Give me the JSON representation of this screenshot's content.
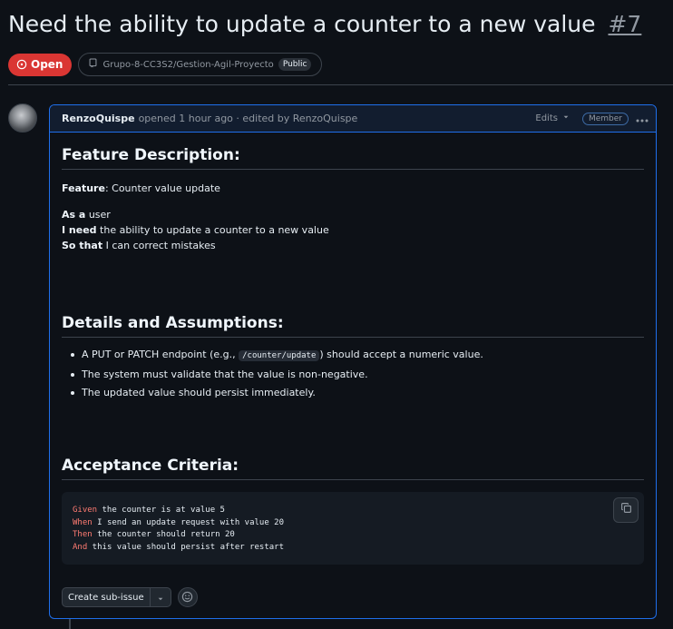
{
  "issue": {
    "title": "Need the ability to update a counter to a new value",
    "number": "#7",
    "state": "Open",
    "repo": "Grupo-8-CC3S2/Gestion-Agil-Proyecto",
    "visibility": "Public"
  },
  "comment": {
    "author": "RenzoQuispe",
    "meta": "opened 1 hour ago · edited by RenzoQuispe",
    "edits_label": "Edits",
    "role_badge": "Member",
    "sections": {
      "feature_heading": "Feature Description:",
      "feature_label": "Feature",
      "feature_value": ": Counter value update",
      "story": [
        {
          "keyword": "As a",
          "text": " user"
        },
        {
          "keyword": "I need",
          "text": " the ability to update a counter to a new value"
        },
        {
          "keyword": "So that",
          "text": " I can correct mistakes"
        }
      ],
      "details_heading": "Details and Assumptions:",
      "details": [
        {
          "before": "A PUT or PATCH endpoint (e.g., ",
          "code": "/counter/update",
          "after": ") should accept a numeric value."
        },
        {
          "text": "The system must validate that the value is non-negative."
        },
        {
          "text": "The updated value should persist immediately."
        }
      ],
      "criteria_heading": "Acceptance Criteria:",
      "criteria": [
        {
          "keyword": "Given",
          "text": " the counter is at value 5"
        },
        {
          "keyword": "When",
          "text": " I send an update request with value 20"
        },
        {
          "keyword": "Then",
          "text": " the counter should return 20"
        },
        {
          "keyword": "And",
          "text": " this value should persist after restart"
        }
      ]
    },
    "actions": {
      "create_sub_issue": "Create sub-issue"
    }
  },
  "colors": {
    "open_state": "#da3633",
    "accent_border": "#1f6feb",
    "keyword": "#ff7b72"
  }
}
